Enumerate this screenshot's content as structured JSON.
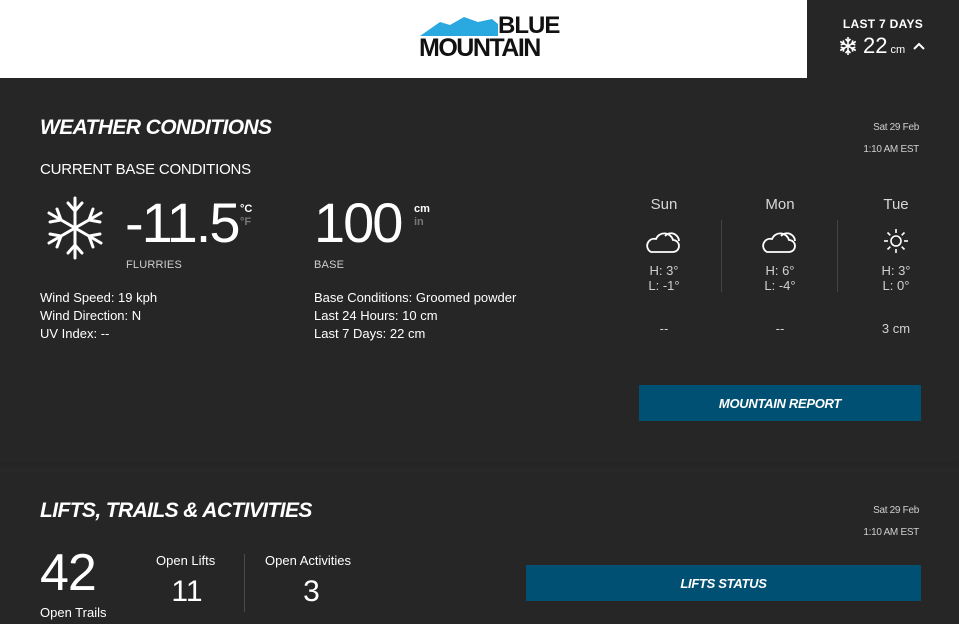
{
  "header": {
    "logo_line1": "BLUE",
    "logo_line2": "MOUNTAIN",
    "snow_label": "LAST 7 DAYS",
    "snow_value": "22",
    "snow_unit": "cm",
    "snow_icon": "snowflake-icon",
    "toggle_icon": "chevron-up-icon"
  },
  "weather": {
    "title": "WEATHER CONDITIONS",
    "date": "Sat 29 Feb",
    "time": "1:10 AM EST",
    "subtitle": "CURRENT BASE CONDITIONS",
    "temperature": "-11.5",
    "unit_c": "°C",
    "unit_f": "°F",
    "condition": "FLURRIES",
    "wind_speed": "Wind Speed: 19 kph",
    "wind_direction": "Wind Direction: N",
    "uv_index": "UV Index: --",
    "base_depth": "100",
    "unit_cm": "cm",
    "unit_in": "in",
    "base_label": "BASE",
    "base_conditions": "Base Conditions: Groomed powder",
    "last_24": "Last 24 Hours: 10 cm",
    "last_7": "Last 7 Days: 22 cm",
    "forecast": [
      {
        "day": "Sun",
        "icon": "partly-cloudy-icon",
        "high": "H: 3°",
        "low": "L: -1°",
        "snow": "--"
      },
      {
        "day": "Mon",
        "icon": "partly-cloudy-icon",
        "high": "H: 6°",
        "low": "L: -4°",
        "snow": "--"
      },
      {
        "day": "Tue",
        "icon": "sun-icon",
        "high": "H: 3°",
        "low": "L: 0°",
        "snow": "3 cm"
      }
    ],
    "report_button": "MOUNTAIN REPORT"
  },
  "lifts": {
    "title": "LIFTS, TRAILS & ACTIVITIES",
    "date": "Sat 29 Feb",
    "time": "1:10 AM EST",
    "open_trails": "42",
    "open_trails_label": "Open Trails",
    "open_lifts_label": "Open Lifts",
    "open_lifts": "11",
    "open_activities_label": "Open Activities",
    "open_activities": "3",
    "status_button": "LIFTS STATUS"
  },
  "colors": {
    "background": "#262626",
    "button": "#005073",
    "logo_blue": "#2aa9e0"
  }
}
